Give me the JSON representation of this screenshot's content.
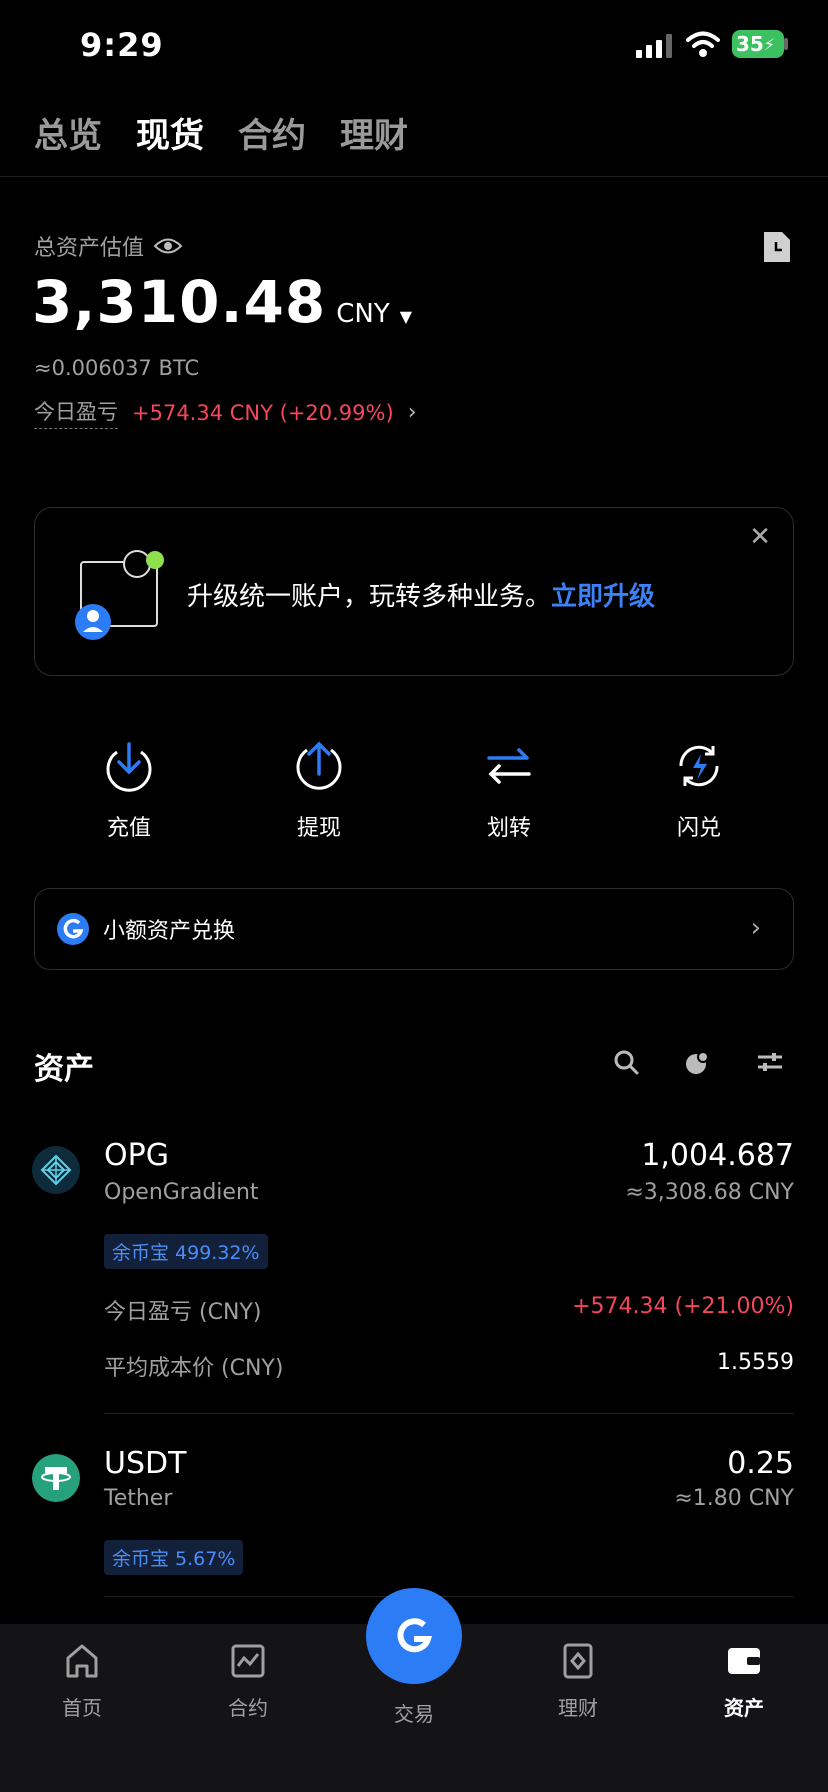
{
  "status_bar": {
    "time": "9:29",
    "battery": "35"
  },
  "tabs": [
    {
      "label": "总览",
      "active": false
    },
    {
      "label": "现货",
      "active": true
    },
    {
      "label": "合约",
      "active": false
    },
    {
      "label": "理财",
      "active": false
    }
  ],
  "summary": {
    "label": "总资产估值",
    "total": "3,310.48",
    "currency": "CNY",
    "btc_equiv": "≈0.006037 BTC",
    "pnl_label": "今日盈亏",
    "pnl_value": "+574.34 CNY (+20.99%)"
  },
  "banner": {
    "text": "升级统一账户，玩转多种业务。",
    "link": "立即升级"
  },
  "actions": [
    {
      "label": "充值",
      "icon": "deposit-icon"
    },
    {
      "label": "提现",
      "icon": "withdraw-icon"
    },
    {
      "label": "划转",
      "icon": "transfer-icon"
    },
    {
      "label": "闪兑",
      "icon": "flash-swap-icon"
    }
  ],
  "small_exchange": {
    "label": "小额资产兑换"
  },
  "assets": {
    "title": "资产",
    "items": [
      {
        "symbol": "OPG",
        "name": "OpenGradient",
        "amount": "1,004.687",
        "amount_cny": "≈3,308.68 CNY",
        "badge": "余币宝 499.32%",
        "pnl_label": "今日盈亏 (CNY)",
        "pnl_value": "+574.34 (+21.00%)",
        "cost_label": "平均成本价 (CNY)",
        "cost_value": "1.5559"
      },
      {
        "symbol": "USDT",
        "name": "Tether",
        "amount": "0.25",
        "amount_cny": "≈1.80 CNY",
        "badge": "余币宝 5.67%"
      }
    ]
  },
  "bottom_nav": [
    {
      "label": "首页",
      "icon": "home-icon"
    },
    {
      "label": "合约",
      "icon": "futures-icon"
    },
    {
      "label": "交易",
      "icon": "trade-icon"
    },
    {
      "label": "理财",
      "icon": "earn-icon"
    },
    {
      "label": "资产",
      "icon": "wallet-icon",
      "active": true
    }
  ],
  "colors": {
    "accent": "#2c7cf6",
    "loss_gain_red": "#f5475c",
    "background": "#000000"
  }
}
